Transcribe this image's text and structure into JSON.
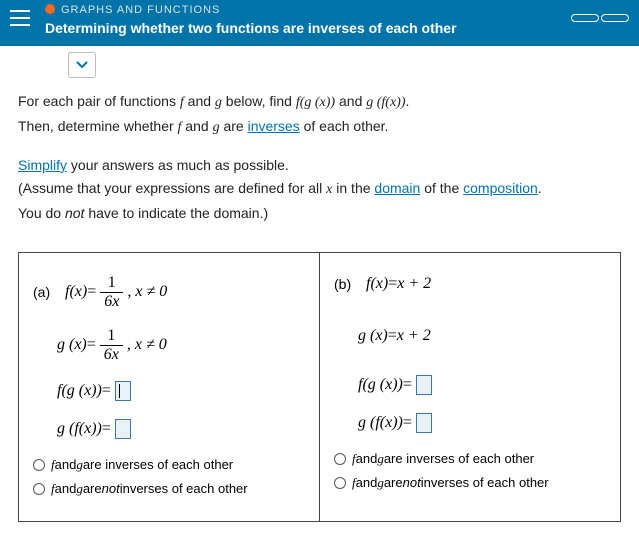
{
  "header": {
    "section": "GRAPHS AND FUNCTIONS",
    "topic": "Determining whether two functions are inverses of each other"
  },
  "intro": {
    "line1_a": "For each pair of functions ",
    "line1_b": " and ",
    "line1_c": " below, find ",
    "line1_d": " and ",
    "line1_e": ".",
    "line2_a": "Then, determine whether ",
    "line2_b": " and ",
    "line2_c": " are ",
    "inverses": "inverses",
    "line2_d": " of each other.",
    "simplify": "Simplify",
    "line3": " your answers as much as possible.",
    "line4_a": "(Assume that your expressions are defined for all ",
    "line4_b": " in the ",
    "domain": "domain",
    "line4_c": " of the ",
    "composition": "composition",
    "line4_d": ".",
    "line5_a": "You do ",
    "not": "not",
    "line5_b": " have to indicate the domain.)"
  },
  "labels": {
    "a": "(a)",
    "b": "(b)",
    "f": "f",
    "g": "g",
    "x": "x",
    "eq": " = ",
    "fx": "f(x)",
    "gx": "g (x)",
    "fgx": "f(g (x))",
    "gfx": "g (f(x))",
    "cond": ",  x ≠ 0",
    "num1": "1",
    "den6x": "6x",
    "xp2": "x + 2",
    "opt_yes_a": " and ",
    "opt_yes_b": " are inverses of each other",
    "opt_no_a": " and ",
    "opt_no_b": " are ",
    "opt_no_c": " inverses of each other"
  }
}
